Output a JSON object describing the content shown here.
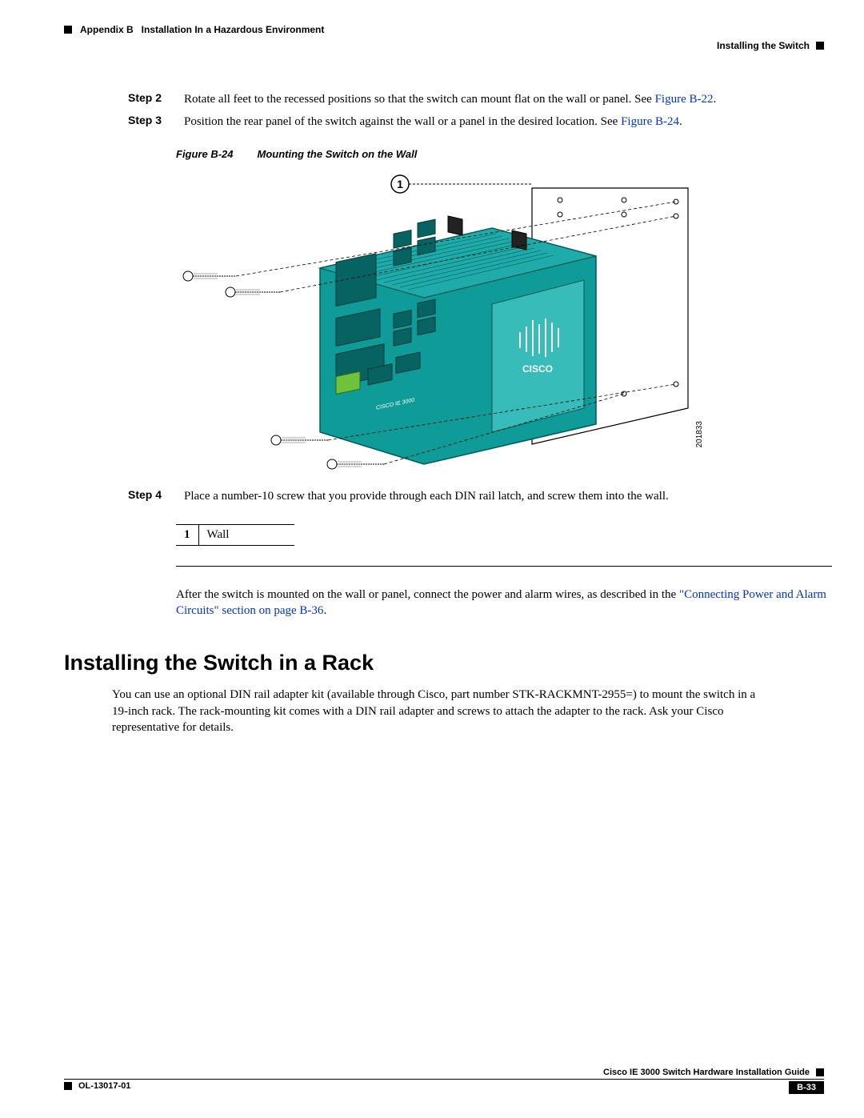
{
  "header": {
    "appendix": "Appendix B",
    "appendixTitle": "Installation In a Hazardous Environment",
    "section": "Installing the Switch"
  },
  "steps": {
    "s2": {
      "label": "Step 2",
      "text": "Rotate all feet to the recessed positions so that the switch can mount flat on the wall or panel. See ",
      "xref": "Figure B-22",
      "suffix": "."
    },
    "s3": {
      "label": "Step 3",
      "text": "Position the rear panel of the switch against the wall or a panel in the desired location. See ",
      "xref": "Figure B-24",
      "suffix": "."
    },
    "s4": {
      "label": "Step 4",
      "text": "Place a number-10 screw that you provide through each DIN rail latch, and screw them into the wall."
    }
  },
  "figure": {
    "num": "Figure B-24",
    "title": "Mounting the Switch on the Wall",
    "callout1": "1",
    "id": "201833"
  },
  "calloutTable": {
    "n1": "1",
    "t1": "Wall"
  },
  "followPara": {
    "text": "After the switch is mounted on the wall or panel, connect the power and alarm wires, as described in the ",
    "xref": "\"Connecting Power and Alarm Circuits\" section on page B-36",
    "suffix": "."
  },
  "h2": "Installing the Switch in a Rack",
  "bodyPara": "You can use an optional DIN rail adapter kit (available through Cisco, part number STK-RACKMNT-2955=) to mount the switch in a 19-inch rack. The rack-mounting kit comes with a DIN rail adapter and screws to attach the adapter to the rack. Ask your Cisco representative for details.",
  "footer": {
    "guide": "Cisco IE 3000 Switch Hardware Installation Guide",
    "docid": "OL-13017-01",
    "page": "B-33"
  }
}
